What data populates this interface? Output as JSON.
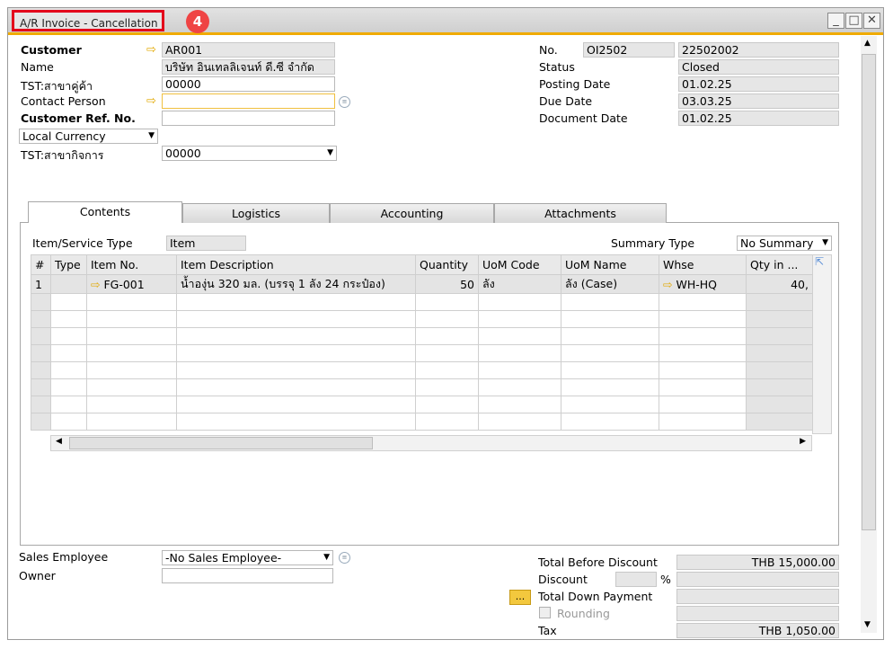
{
  "window": {
    "title": "A/R Invoice - Cancellation",
    "badge": "4",
    "minimize": "_",
    "maximize": "□",
    "close": "✕"
  },
  "header_left": {
    "customer_label": "Customer",
    "customer_value": "AR001",
    "name_label": "Name",
    "name_value": "บริษัท อินเทลลิเจนท์ ดี.ซี จำกัด",
    "branch_label": "TST:สาขาคู่ค้า",
    "branch_value": "00000",
    "contact_label": "Contact Person",
    "contact_value": "",
    "ref_label": "Customer Ref. No.",
    "ref_value": "",
    "currency_value": "Local Currency",
    "biz_branch_label": "TST:สาขากิจการ",
    "biz_branch_value": "00000"
  },
  "header_right": {
    "no_label": "No.",
    "series": "OI2502",
    "no_value": "22502002",
    "status_label": "Status",
    "status_value": "Closed",
    "posting_label": "Posting Date",
    "posting_value": "01.02.25",
    "due_label": "Due Date",
    "due_value": "03.03.25",
    "docdate_label": "Document Date",
    "docdate_value": "01.02.25"
  },
  "tabs": [
    "Contents",
    "Logistics",
    "Accounting",
    "Attachments"
  ],
  "contents": {
    "item_type_label": "Item/Service Type",
    "item_type_value": "Item",
    "summary_label": "Summary Type",
    "summary_value": "No Summary",
    "columns": [
      "#",
      "Type",
      "Item No.",
      "Item Description",
      "Quantity",
      "UoM Code",
      "UoM Name",
      "Whse",
      "Qty in ..."
    ],
    "rows": [
      {
        "num": "1",
        "type": "",
        "item_no": "FG-001",
        "desc": "น้ำองุ่น 320 มล. (บรรจุ 1 ลัง 24 กระป๋อง)",
        "qty": "50",
        "uom_code": "ลัง",
        "uom_name": "ลัง (Case)",
        "whse": "WH-HQ",
        "qty_in": "40,"
      }
    ]
  },
  "footer_left": {
    "sales_emp_label": "Sales Employee",
    "sales_emp_value": "-No Sales Employee-",
    "owner_label": "Owner",
    "owner_value": ""
  },
  "footer_right": {
    "total_before_label": "Total Before Discount",
    "total_before_value": "THB 15,000.00",
    "discount_label": "Discount",
    "discount_pct": "%",
    "down_payment_label": "Total Down Payment",
    "dots": "...",
    "rounding_label": "Rounding",
    "tax_label": "Tax",
    "tax_value": "THB 1,050.00"
  }
}
